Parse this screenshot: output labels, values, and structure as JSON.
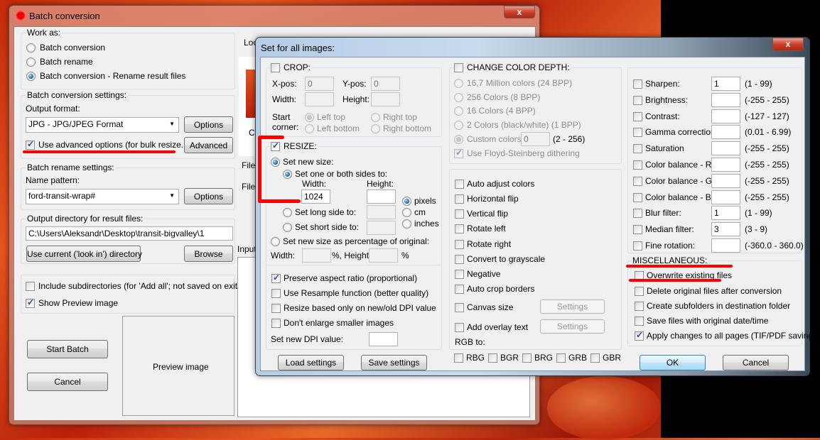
{
  "main_window": {
    "title": "Batch conversion",
    "close_label": "x",
    "work_as": {
      "label": "Work as:",
      "options": [
        "Batch conversion",
        "Batch rename",
        "Batch conversion - Rename result files"
      ],
      "selected": 2
    },
    "conversion_settings": {
      "label": "Batch conversion settings:",
      "output_format_label": "Output format:",
      "output_format_value": "JPG - JPG/JPEG Format",
      "options_button": "Options",
      "use_advanced_label": "Use advanced options (for bulk resize...)",
      "use_advanced_checked": true,
      "advanced_button": "Advanced"
    },
    "rename_settings": {
      "label": "Batch rename settings:",
      "name_pattern_label": "Name pattern:",
      "name_pattern_value": "ford-transit-wrap#",
      "options_button": "Options"
    },
    "output_dir": {
      "label": "Output directory for result files:",
      "value": "C:\\Users\\Aleksandr\\Desktop\\transit-bigvalley\\1",
      "use_current_button": "Use current ('look in') directory",
      "browse_button": "Browse"
    },
    "include_subdirs_label": "Include subdirectories (for 'Add all'; not saved on exit)",
    "include_subdirs_checked": false,
    "show_preview_label": "Show Preview image",
    "show_preview_checked": true,
    "start_batch_button": "Start Batch",
    "cancel_button": "Cancel",
    "preview_label": "Preview image",
    "look_in_label": "Loo",
    "file_label": "File",
    "files_label": "Files",
    "input_label": "Input",
    "thumb_caption": "C"
  },
  "dialog": {
    "title": "Set for all images:",
    "close_label": "x",
    "crop": {
      "label": "CROP:",
      "checked": false,
      "xpos_label": "X-pos:",
      "xpos_value": "0",
      "ypos_label": "Y-pos:",
      "ypos_value": "0",
      "width_label": "Width:",
      "width_value": "",
      "height_label": "Height:",
      "height_value": "",
      "start_corner_label_1": "Start",
      "start_corner_label_2": "corner:",
      "corners": [
        "Left top",
        "Right top",
        "Left bottom",
        "Right bottom"
      ],
      "selected_corner": 0
    },
    "resize": {
      "label": "RESIZE:",
      "checked": true,
      "set_new_size_label": "Set new size:",
      "set_new_size_selected": true,
      "one_or_both_label": "Set one or both sides to:",
      "width_label": "Width:",
      "width_value": "1024",
      "height_label": "Height:",
      "height_value": "",
      "units": [
        "pixels",
        "cm",
        "inches"
      ],
      "selected_unit": 0,
      "long_side_label": "Set long side to:",
      "short_side_label": "Set short side to:",
      "percentage_label": "Set new size as percentage of original:",
      "pct_width_label": "Width:",
      "pct_height_label": "%, Height:",
      "pct_suffix": "%",
      "preserve_aspect_label": "Preserve aspect ratio (proportional)",
      "preserve_aspect_checked": true,
      "resample_label": "Use Resample function (better quality)",
      "dpi_only_label": "Resize based only on new/old DPI value",
      "dont_enlarge_label": "Don't enlarge smaller images",
      "new_dpi_label": "Set new DPI value:",
      "new_dpi_value": ""
    },
    "load_settings_button": "Load settings",
    "save_settings_button": "Save settings",
    "color_depth": {
      "label": "CHANGE COLOR DEPTH:",
      "checked": false,
      "options": [
        "16,7 Million colors (24 BPP)",
        "256 Colors (8 BPP)",
        "16 Colors (4 BPP)",
        "2 Colors (black/white) (1 BPP)",
        "Custom colors:"
      ],
      "selected": 4,
      "custom_value": "0",
      "custom_range": "(2 - 256)",
      "dithering_label": "Use Floyd-Steinberg dithering",
      "dithering_checked": true
    },
    "transforms": [
      "Auto adjust colors",
      "Horizontal flip",
      "Vertical flip",
      "Rotate left",
      "Rotate right",
      "Convert to grayscale",
      "Negative",
      "Auto crop borders"
    ],
    "canvas_size_label": "Canvas size",
    "overlay_text_label": "Add overlay text",
    "settings_button": "Settings",
    "rgb_to_label": "RGB to:",
    "rgb_options": [
      "RBG",
      "BGR",
      "BRG",
      "GRB",
      "GBR"
    ],
    "adjustments": [
      {
        "label": "Sharpen:",
        "value": "1",
        "range": "(1  -  99)"
      },
      {
        "label": "Brightness:",
        "value": "",
        "range": "(-255  -  255)"
      },
      {
        "label": "Contrast:",
        "value": "",
        "range": "(-127  -  127)"
      },
      {
        "label": "Gamma correction:",
        "value": "",
        "range": "(0.01  -  6.99)"
      },
      {
        "label": "Saturation",
        "value": "",
        "range": "(-255  -  255)"
      },
      {
        "label": "Color balance - R:",
        "value": "",
        "range": "(-255  -  255)"
      },
      {
        "label": "Color balance - G:",
        "value": "",
        "range": "(-255  -  255)"
      },
      {
        "label": "Color balance - B:",
        "value": "",
        "range": "(-255  -  255)"
      },
      {
        "label": "Blur filter:",
        "value": "1",
        "range": "(1  -  99)"
      },
      {
        "label": "Median filter:",
        "value": "3",
        "range": "(3  -  9)"
      },
      {
        "label": "Fine rotation:",
        "value": "",
        "range": "(-360.0  -  360.0)"
      }
    ],
    "misc": {
      "label": "MISCELLANEOUS:",
      "items": [
        {
          "label": "Overwrite existing files",
          "checked": false
        },
        {
          "label": "Delete original files after conversion",
          "checked": false
        },
        {
          "label": "Create subfolders in destination folder",
          "checked": false
        },
        {
          "label": "Save files with original date/time",
          "checked": false
        },
        {
          "label": "Apply changes to all pages (TIF/PDF saving)",
          "checked": true
        }
      ]
    },
    "ok_button": "OK",
    "cancel_button": "Cancel"
  },
  "annotation_color": "#ff0000"
}
